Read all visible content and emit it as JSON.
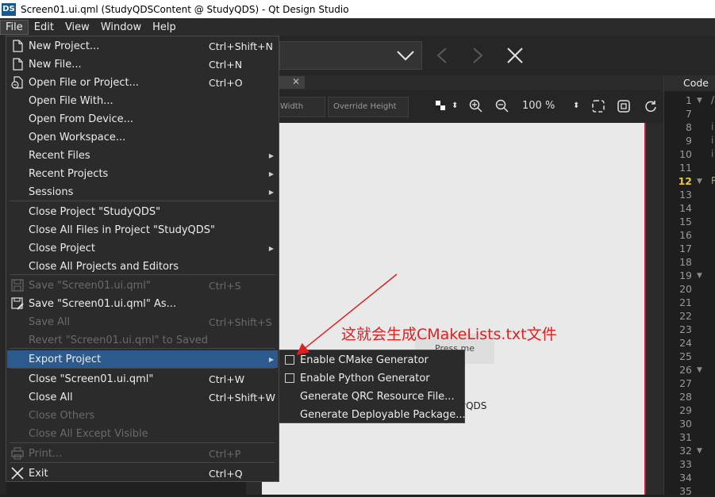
{
  "window": {
    "logo": "DS",
    "title": "Screen01.ui.qml (StudyQDSContent @ StudyQDS) - Qt Design Studio"
  },
  "menubar": [
    {
      "label": "File"
    },
    {
      "label": "Edit"
    },
    {
      "label": "View"
    },
    {
      "label": "Window"
    },
    {
      "label": "Help"
    }
  ],
  "editor": {
    "tab_close": "✕",
    "fields": {
      "width": "Width",
      "override_height": "Override Height"
    },
    "zoom": "100 %",
    "canvas_button": "Press me",
    "canvas_text": "yQDS"
  },
  "code_panel": {
    "header": "Code",
    "line_numbers": [
      "1",
      "7",
      "8",
      "9",
      "10",
      "11",
      "12",
      "13",
      "14",
      "15",
      "16",
      "17",
      "18",
      "19",
      "20",
      "21",
      "22",
      "23",
      "24",
      "25",
      "26",
      "27",
      "28",
      "29",
      "30",
      "31",
      "32",
      "33",
      "34",
      "35"
    ],
    "current_line": "12",
    "fold_lines": [
      "1",
      "12",
      "19",
      "26",
      "32"
    ],
    "fragments": [
      {
        "text": "/",
        "color": "#9a9a9a"
      },
      {
        "text": "i",
        "color": "#4a8ad4"
      },
      {
        "text": "i",
        "color": "#4a8ad4"
      },
      {
        "text": "i",
        "color": "#4a8ad4"
      },
      {
        "text": "R",
        "color": "#7cb85c"
      }
    ]
  },
  "file_menu": {
    "items": [
      {
        "label": "New Project...",
        "shortcut": "Ctrl+Shift+N",
        "icon": "new-project-icon"
      },
      {
        "label": "New File...",
        "shortcut": "Ctrl+N",
        "icon": "new-file-icon"
      },
      {
        "label": "Open File or Project...",
        "shortcut": "Ctrl+O",
        "icon": "open-file-icon"
      },
      {
        "label": "Open File With...",
        "shortcut": ""
      },
      {
        "label": "Open From Device...",
        "shortcut": ""
      },
      {
        "label": "Open Workspace...",
        "shortcut": ""
      },
      {
        "label": "Recent Files",
        "shortcut": "",
        "submenu": true
      },
      {
        "label": "Recent Projects",
        "shortcut": "",
        "submenu": true
      },
      {
        "label": "Sessions",
        "shortcut": "",
        "submenu": true
      },
      {
        "label": "Close Project \"StudyQDS\"",
        "shortcut": ""
      },
      {
        "label": "Close All Files in Project \"StudyQDS\"",
        "shortcut": ""
      },
      {
        "label": "Close Project",
        "shortcut": "",
        "submenu": true
      },
      {
        "label": "Close All Projects and Editors",
        "shortcut": ""
      },
      {
        "label": "Save \"Screen01.ui.qml\"",
        "shortcut": "Ctrl+S",
        "disabled": true,
        "icon": "save-icon"
      },
      {
        "label": "Save \"Screen01.ui.qml\" As...",
        "shortcut": "",
        "icon": "save-as-icon"
      },
      {
        "label": "Save All",
        "shortcut": "Ctrl+Shift+S",
        "disabled": true
      },
      {
        "label": "Revert \"Screen01.ui.qml\" to Saved",
        "shortcut": "",
        "disabled": true
      },
      {
        "label": "Export Project",
        "shortcut": "",
        "submenu": true,
        "highlight": true
      },
      {
        "label": "Close \"Screen01.ui.qml\"",
        "shortcut": "Ctrl+W"
      },
      {
        "label": "Close All",
        "shortcut": "Ctrl+Shift+W"
      },
      {
        "label": "Close Others",
        "shortcut": "",
        "disabled": true
      },
      {
        "label": "Close All Except Visible",
        "shortcut": "",
        "disabled": true
      },
      {
        "label": "Print...",
        "shortcut": "Ctrl+P",
        "disabled": true,
        "icon": "print-icon"
      },
      {
        "label": "Exit",
        "shortcut": "Ctrl+Q",
        "icon": "exit-icon"
      }
    ]
  },
  "export_submenu": {
    "items": [
      {
        "label": "Enable CMake Generator",
        "checkbox": true,
        "checked": false
      },
      {
        "label": "Enable Python Generator",
        "checkbox": true,
        "checked": false
      },
      {
        "label": "Generate QRC Resource File...",
        "checkbox": false
      },
      {
        "label": "Generate Deployable Package...",
        "checkbox": false
      }
    ]
  },
  "annotation": {
    "text": "这就会生成CMakeLists.txt文件",
    "color": "#e02020"
  }
}
